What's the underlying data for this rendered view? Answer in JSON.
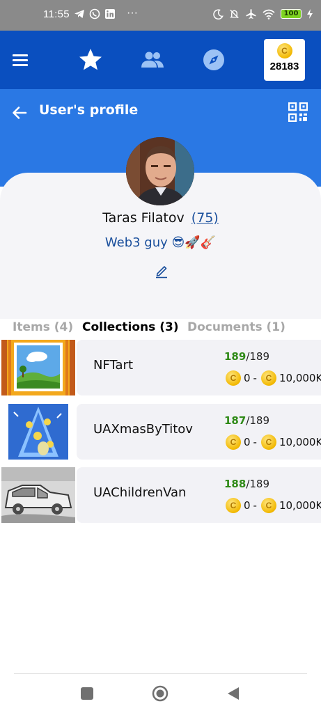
{
  "status_bar": {
    "time": "11:55",
    "left_icons": [
      "telegram-icon",
      "viber-icon",
      "linkedin-icon",
      "more-icon"
    ],
    "right_icons": [
      "moon-icon",
      "bell-off-icon",
      "airplane-icon",
      "wifi-icon",
      "battery-icon",
      "charging-icon"
    ],
    "battery_level": "100",
    "more": "···"
  },
  "top_bar": {
    "menu_icon": "hamburger-icon",
    "nav_icons": [
      "star-icon",
      "people-icon",
      "compass-icon"
    ],
    "coin_balance": "28183",
    "coin_symbol": "C"
  },
  "header": {
    "title": "User's profile",
    "back_icon": "arrow-left-icon",
    "qr_icon": "qr-code-icon"
  },
  "profile": {
    "name": "Taras Filatov",
    "level": "(75)",
    "bio": "Web3 guy 😎🚀🎸",
    "edit_icon": "pencil-icon"
  },
  "tabs": [
    {
      "label": "Items (4)",
      "active": false
    },
    {
      "label": "Collections (3)",
      "active": true
    },
    {
      "label": "Documents (1)",
      "active": false
    }
  ],
  "collections": [
    {
      "name": "NFTart",
      "owned": "189",
      "total": "/189",
      "min_price": "0",
      "separator": "-",
      "max_price": "10,000K"
    },
    {
      "name": "UAXmasByTitov",
      "owned": "187",
      "total": "/189",
      "min_price": "0",
      "separator": "-",
      "max_price": "10,000K"
    },
    {
      "name": "UAChildrenVan",
      "owned": "188",
      "total": "/189",
      "min_price": "0",
      "separator": "-",
      "max_price": "10,000K"
    }
  ],
  "colors": {
    "top_bar": "#0a4fbf",
    "header": "#2a78e4",
    "owned_count": "#2f8a17",
    "link": "#1a4f9c"
  },
  "system_nav": [
    "recents-square-icon",
    "home-circle-icon",
    "back-triangle-icon"
  ]
}
